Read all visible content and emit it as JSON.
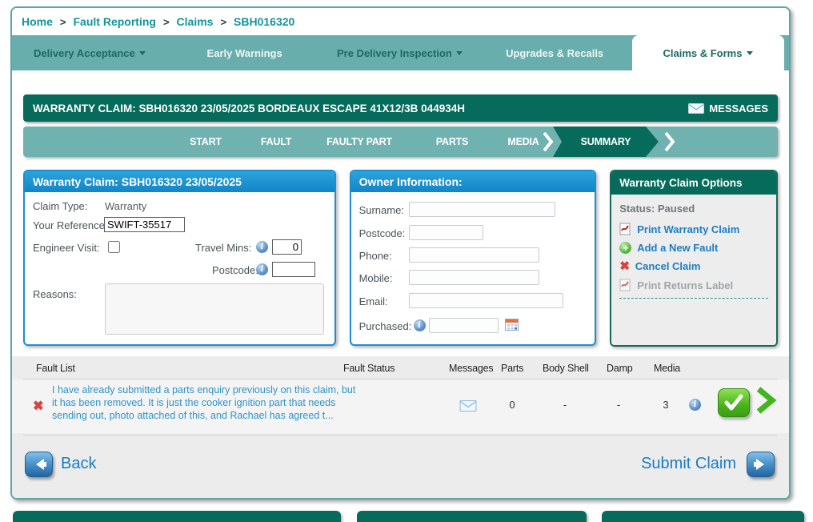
{
  "colors": {
    "teal_bar": "#68AEAC",
    "dark_green": "#076B5C",
    "blue_panel_header": "#1B90D0",
    "link_blue": "#1C7CC4",
    "fault_link_blue": "#2E93C9",
    "delete_red": "#D8413D",
    "check_green": "#49B21C"
  },
  "breadcrumb": {
    "separator": ">",
    "items": [
      {
        "label": "Home"
      },
      {
        "label": "Fault Reporting"
      },
      {
        "label": "Claims"
      },
      {
        "label": "SBH016320"
      }
    ]
  },
  "tabs": [
    {
      "label": "Delivery Acceptance",
      "dropdown": true
    },
    {
      "label": "Early Warnings",
      "dropdown": false
    },
    {
      "label": "Pre Delivery Inspection",
      "dropdown": true
    },
    {
      "label": "Upgrades & Recalls",
      "dropdown": false
    },
    {
      "label": "Claims & Forms",
      "dropdown": true,
      "active": true
    }
  ],
  "claim_header": {
    "title": "WARRANTY CLAIM: SBH016320 23/05/2025 BORDEAUX ESCAPE 41X12/3B 044934H",
    "messages_label": "MESSAGES"
  },
  "steps": [
    "START",
    "FAULT",
    "FAULTY PART",
    "PARTS",
    "MEDIA",
    "SUMMARY"
  ],
  "claim_panel": {
    "title": "Warranty Claim: SBH016320 23/05/2025",
    "claim_type_label": "Claim Type:",
    "claim_type_value": "Warranty",
    "reference_label": "Your Reference:",
    "reference_value": "SWIFT-35517",
    "engineer_visit_label": "Engineer Visit:",
    "travel_mins_label": "Travel Mins:",
    "travel_mins_value": "0",
    "postcode_label": "Postcode:",
    "postcode_value": "",
    "reasons_label": "Reasons:",
    "reasons_value": ""
  },
  "owner_panel": {
    "title": "Owner Information:",
    "surname_label": "Surname:",
    "surname_value": "",
    "postcode_label": "Postcode:",
    "postcode_value": "",
    "phone_label": "Phone:",
    "phone_value": "",
    "mobile_label": "Mobile:",
    "mobile_value": "",
    "email_label": "Email:",
    "email_value": "",
    "purchased_label": "Purchased:",
    "purchased_value": ""
  },
  "options_panel": {
    "title": "Warranty Claim Options",
    "status_text": "Status: Paused",
    "actions": [
      {
        "label": "Print Warranty Claim",
        "icon": "pdf-icon",
        "enabled": true
      },
      {
        "label": "Add a New Fault",
        "icon": "add-icon",
        "enabled": true
      },
      {
        "label": "Cancel Claim",
        "icon": "cancel-icon",
        "enabled": true
      },
      {
        "label": "Print Returns Label",
        "icon": "pdf-icon",
        "enabled": false
      }
    ]
  },
  "fault_table": {
    "headers": {
      "fault_list": "Fault List",
      "fault_status": "Fault Status",
      "messages": "Messages",
      "parts": "Parts",
      "body_shell": "Body Shell",
      "damp": "Damp",
      "media": "Media"
    },
    "rows": [
      {
        "fault_text": "I have already submitted a parts enquiry previously on this claim, but it has been removed. It is just the cooker ignition part that needs sending out, photo attached of this, and Rachael has agreed t...",
        "fault_status": "",
        "parts": "0",
        "body_shell": "-",
        "damp": "-",
        "media": "3"
      }
    ]
  },
  "footer": {
    "back_label": "Back",
    "submit_label": "Submit Claim"
  }
}
